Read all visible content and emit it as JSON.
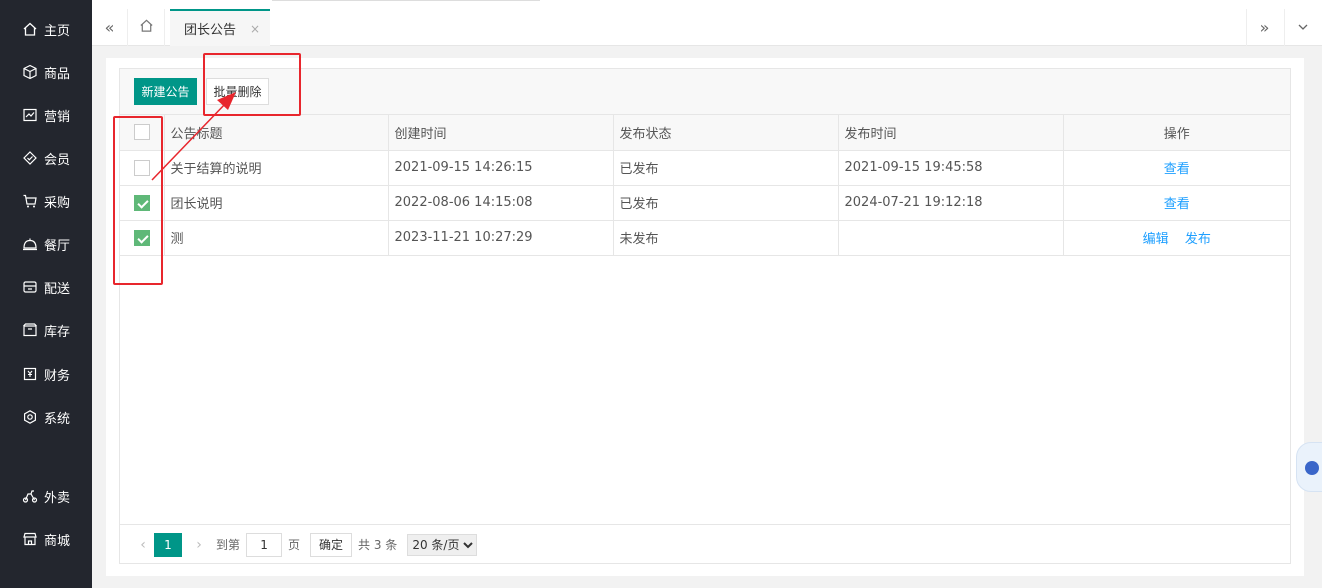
{
  "sidebar": {
    "items": [
      {
        "label": "主页",
        "icon": "home-icon"
      },
      {
        "label": "商品",
        "icon": "box-icon"
      },
      {
        "label": "营销",
        "icon": "chart-icon"
      },
      {
        "label": "会员",
        "icon": "diamond-icon"
      },
      {
        "label": "采购",
        "icon": "cart-icon"
      },
      {
        "label": "餐厅",
        "icon": "cloche-icon"
      },
      {
        "label": "配送",
        "icon": "delivery-icon"
      },
      {
        "label": "库存",
        "icon": "archive-icon"
      },
      {
        "label": "财务",
        "icon": "finance-icon"
      },
      {
        "label": "系统",
        "icon": "settings-icon"
      },
      {
        "label": "外卖",
        "icon": "scooter-icon"
      },
      {
        "label": "商城",
        "icon": "store-icon"
      }
    ]
  },
  "tabs": {
    "active": "团长公告",
    "close": "×",
    "prev": "«",
    "next": "»",
    "more": "⌄"
  },
  "toolbar": {
    "new_label": "新建公告",
    "batch_delete_label": "批量删除"
  },
  "table": {
    "headers": [
      "公告标题",
      "创建时间",
      "发布状态",
      "发布时间",
      "操作"
    ],
    "rows": [
      {
        "checked": false,
        "title": "关于结算的说明",
        "created": "2021-09-15 14:26:15",
        "status": "已发布",
        "published": "2021-09-15 19:45:58",
        "actions": [
          "查看"
        ]
      },
      {
        "checked": true,
        "title": "团长说明",
        "created": "2022-08-06 14:15:08",
        "status": "已发布",
        "published": "2024-07-21 19:12:18",
        "actions": [
          "查看"
        ]
      },
      {
        "checked": true,
        "title": "测",
        "created": "2023-11-21 10:27:29",
        "status": "未发布",
        "published": "",
        "actions": [
          "编辑",
          "发布"
        ]
      }
    ]
  },
  "pager": {
    "current": "1",
    "goto_label": "到第",
    "goto_value": "1",
    "page_label": "页",
    "confirm": "确定",
    "total": "共 3 条",
    "page_size": "20 条/页",
    "prev": "‹",
    "next": "›"
  },
  "colors": {
    "primary": "#009688",
    "sidebar_bg": "#23262e",
    "link": "#1e9fff",
    "annotation": "#e8262d",
    "checkbox_checked": "#5fb878"
  }
}
